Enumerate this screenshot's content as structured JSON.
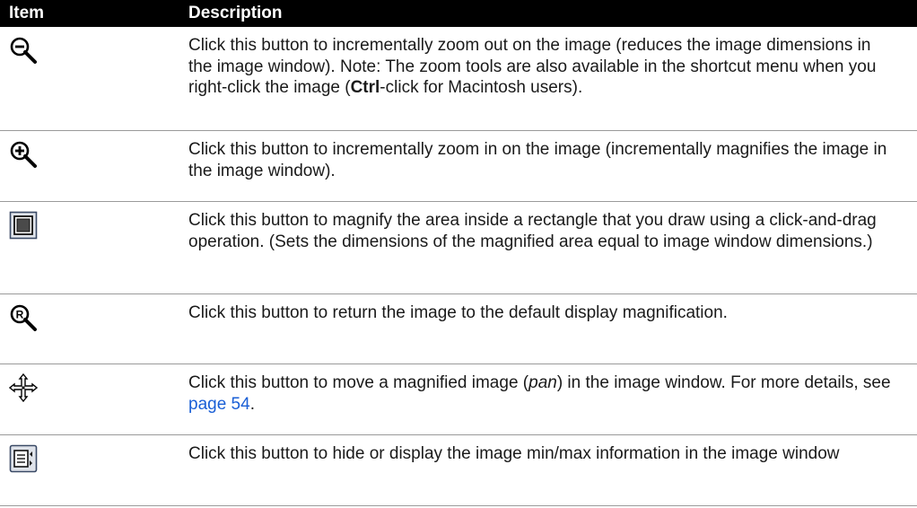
{
  "header": {
    "item": "Item",
    "description": "Description"
  },
  "rows": [
    {
      "icon": "zoom-out-icon",
      "text_a": "Click this button to incrementally zoom out on the image (reduces the image dimensions in the image window). Note: The zoom tools are also available in the shortcut menu when you right-click the image (",
      "bold": "Ctrl",
      "text_b": "-click for Macintosh users)."
    },
    {
      "icon": "zoom-in-icon",
      "text": "Click this button to incrementally zoom in on the image (incrementally magnifies the image in the image window)."
    },
    {
      "icon": "zoom-area-icon",
      "text": "Click this button to magnify the area inside a rectangle that you draw using a click-and-drag operation. (Sets the dimensions of the magnified area equal to image window dimensions.)"
    },
    {
      "icon": "zoom-reset-icon",
      "text": "Click this button to return the image to the default display magnification."
    },
    {
      "icon": "pan-icon",
      "text_a": "Click this button to move a magnified image (",
      "italic": "pan",
      "text_b": ") in the image window. For more details, see ",
      "link": "page 54",
      "text_c": "."
    },
    {
      "icon": "min-max-info-icon",
      "text": "Click this button to hide or display the image min/max information in the image window"
    }
  ]
}
